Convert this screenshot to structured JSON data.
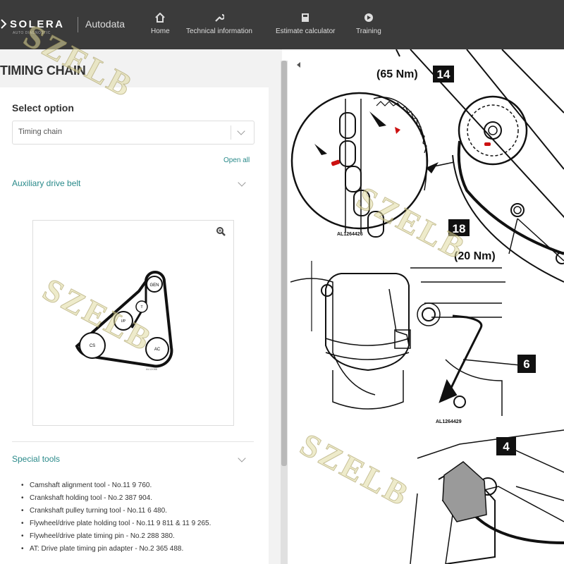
{
  "header": {
    "logo": "SOLERA",
    "logo_sub": "AUTO DIAGNOSTIC",
    "brand": "Autodata",
    "nav": [
      {
        "label": "Home",
        "icon": "home-icon"
      },
      {
        "label": "Technical information",
        "icon": "wrench-icon"
      },
      {
        "label": "Estimate calculator",
        "icon": "calculator-icon"
      },
      {
        "label": "Training",
        "icon": "play-icon"
      }
    ]
  },
  "sidebar": {
    "title": "TIMING CHAIN",
    "select_label": "Select option",
    "select_value": "Timing chain",
    "open_all": "Open all",
    "section_drive_belt": "Auxiliary drive belt",
    "belt_diagram": {
      "labels": [
        "GEN",
        "T",
        "I/P",
        "CS",
        "AC"
      ],
      "caption": "AL12066"
    },
    "section_tools": "Special tools",
    "tools": [
      "Camshaft alignment tool - No.11 9 760.",
      "Crankshaft holding tool - No.2 387 904.",
      "Crankshaft pulley turning tool - No.11 6 480.",
      "Flywheel/drive plate holding tool - No.11 9 811 & 11 9 265.",
      "Flywheel/drive plate timing pin - No.2 288 380.",
      "AT: Drive plate timing pin adapter - No.2 365 488."
    ]
  },
  "drawing": {
    "torque_top": "(65 Nm)",
    "torque_mid": "(20 Nm)",
    "callouts": [
      "14",
      "18",
      "6",
      "4"
    ],
    "fig_codes": [
      "AL1264426",
      "AL1264429"
    ]
  },
  "watermark": "SZELB",
  "colors": {
    "header_bg": "#3b3b3b",
    "accent": "#2a8a8a",
    "sidebar_bg": "#f2f2f2",
    "marker_red": "#cc1111"
  }
}
